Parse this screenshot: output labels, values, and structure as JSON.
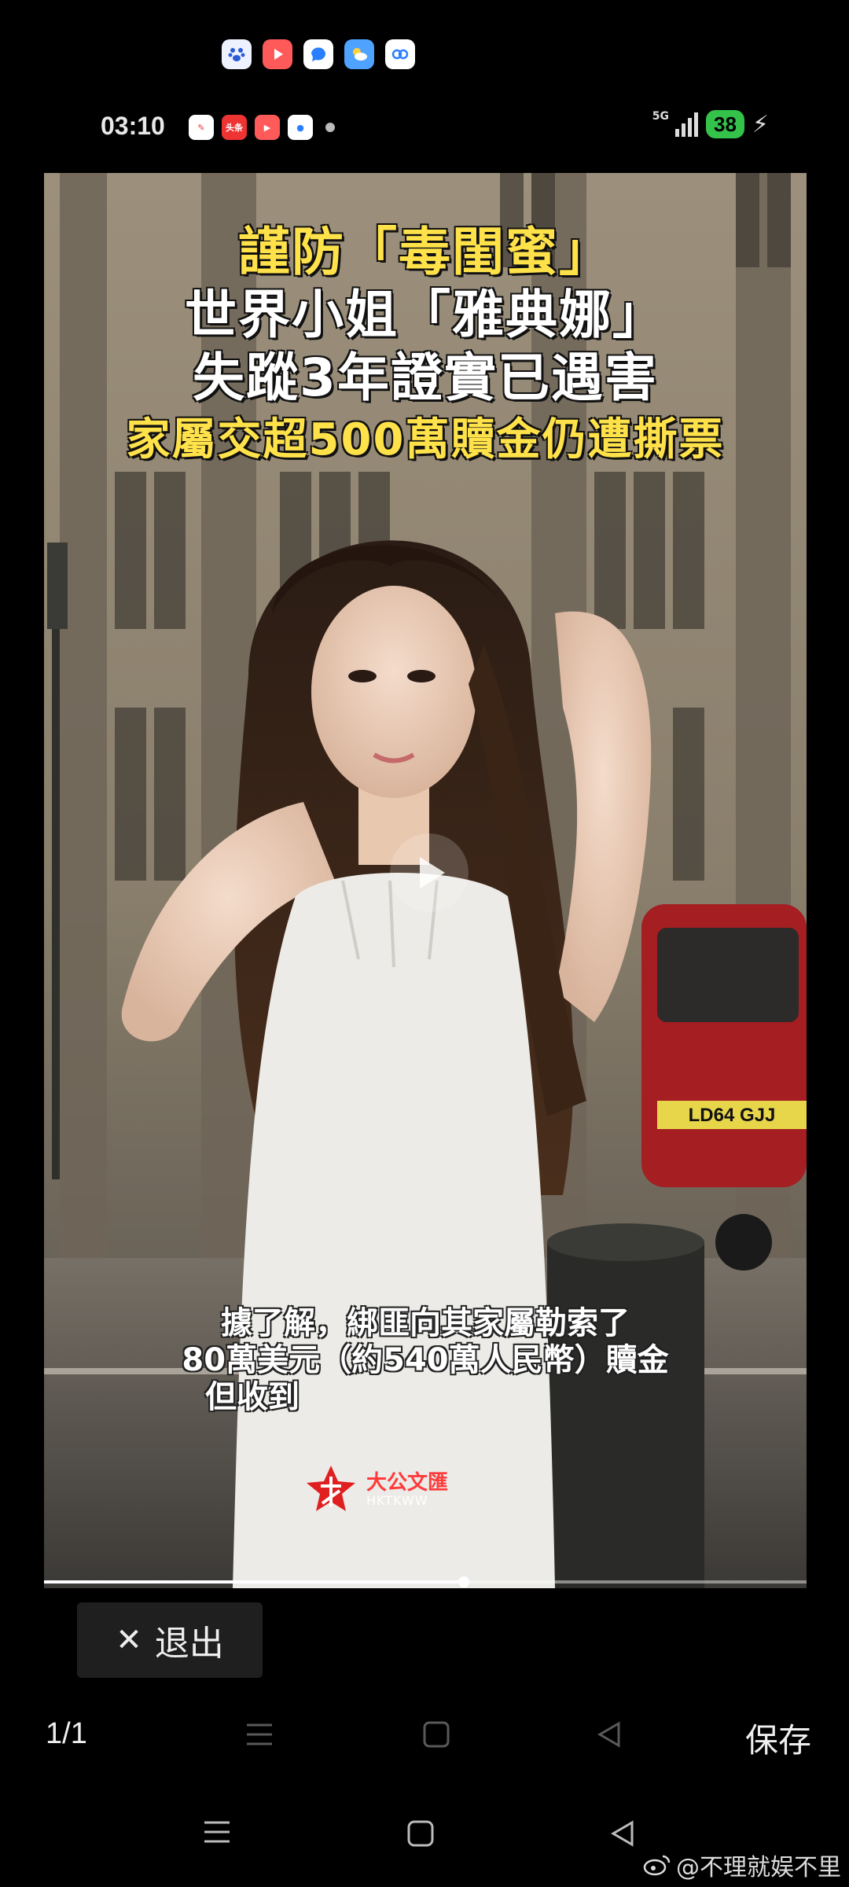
{
  "notifications": {
    "icons": [
      "baidu-paw-icon",
      "video-play-icon",
      "chat-bubble-icon",
      "weather-icon",
      "cloud-sync-icon"
    ]
  },
  "status_bar": {
    "time": "03:10",
    "network": "5G",
    "battery": "38",
    "mini_app_label": "头条"
  },
  "video": {
    "headline": {
      "line1": "謹防「毒閨蜜」",
      "line2": "世界小姐「雅典娜」",
      "line3": "失蹤3年證實已遇害",
      "line4": "家屬交超500萬贖金仍遭撕票"
    },
    "subtitle": {
      "line1": "據了解，綁匪向其家屬勒索了",
      "line2": "80萬美元（約540萬人民幣）贖金",
      "line3": "但收到"
    },
    "logo": {
      "name_cn": "大公文匯",
      "name_en": "HKTKWW"
    },
    "plate": "LD64 GJJ",
    "progress": 0.55
  },
  "exit_button": {
    "label": "退出"
  },
  "viewer": {
    "page_count": "1/1",
    "save_label": "保存"
  },
  "watermark": {
    "text": "@不理就娱不里"
  },
  "colors": {
    "headline_yellow": "#ffe24a",
    "battery_green": "#35c24a",
    "logo_red": "#e02020"
  }
}
